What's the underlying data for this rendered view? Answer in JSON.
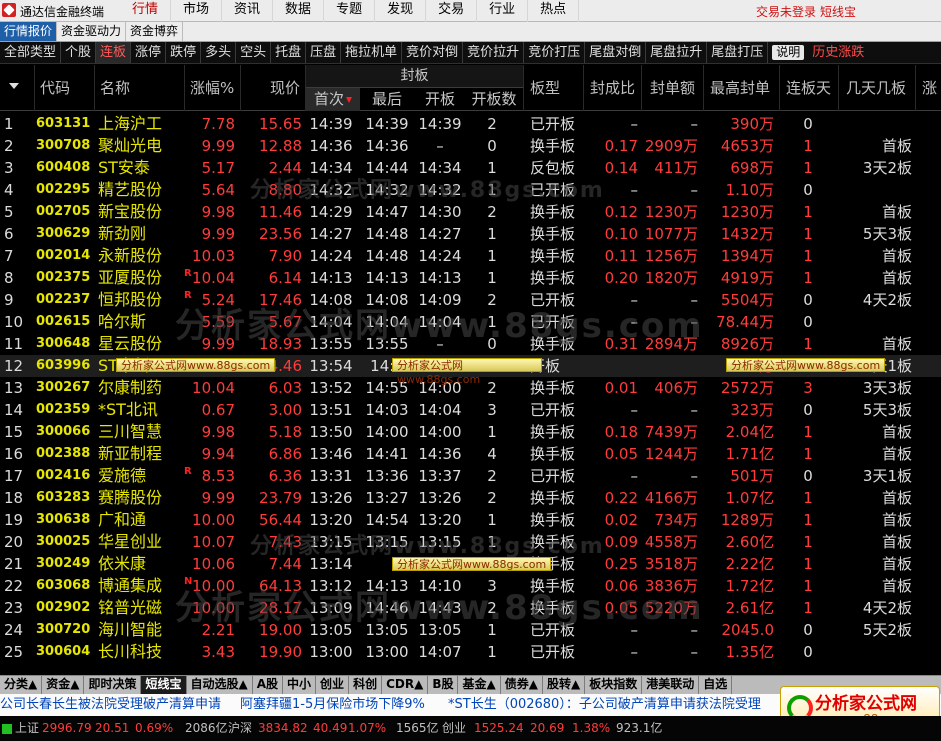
{
  "app": {
    "title": "通达信金融终端",
    "menu": [
      "行情",
      "市场",
      "资讯",
      "数据",
      "专题",
      "发现",
      "交易",
      "行业",
      "热点"
    ],
    "active_menu": 0,
    "login_status": "交易未登录",
    "short_line": "短线宝"
  },
  "subtabs": [
    "行情报价",
    "资金驱动力",
    "资金博弈"
  ],
  "categories": [
    "全部类型",
    "个股",
    "连板",
    "涨停",
    "跌停",
    "多头",
    "空头",
    "托盘",
    "压盘",
    "拖拉机单",
    "竞价对倒",
    "竞价拉升",
    "竞价打压",
    "尾盘对倒",
    "尾盘拉升",
    "尾盘打压"
  ],
  "active_category": 2,
  "cat_button": "说明",
  "cat_extra": "历史涨跌",
  "columns": {
    "code": "代码",
    "name": "名称",
    "chg": "涨幅%",
    "price": "现价",
    "group": "封板",
    "first": "首次",
    "last": "最后",
    "open": "开板",
    "open_count": "开板数",
    "btype": "板型",
    "ratio": "封成比",
    "famt": "封单额",
    "fmax": "最高封单",
    "days": "连板天",
    "nban": "几天几板",
    "more": "涨"
  },
  "rows": [
    {
      "idx": "1",
      "code": "603131",
      "name": "上海沪工",
      "mark": "",
      "chg": "7.78",
      "price": "15.65",
      "t1": "14:39",
      "t2": "14:39",
      "t3": "14:39",
      "opens": "2",
      "btype": "已开板",
      "ratio": "–",
      "famt": "–",
      "fmax": "390万",
      "days": "0",
      "nban": ""
    },
    {
      "idx": "2",
      "code": "300708",
      "name": "聚灿光电",
      "mark": "",
      "chg": "9.99",
      "price": "12.88",
      "t1": "14:36",
      "t2": "14:36",
      "t3": "–",
      "opens": "0",
      "btype": "换手板",
      "ratio": "0.17",
      "famt": "2909万",
      "fmax": "4653万",
      "days": "1",
      "nban": "首板"
    },
    {
      "idx": "3",
      "code": "600408",
      "name": "ST安泰",
      "mark": "",
      "chg": "5.17",
      "price": "2.44",
      "t1": "14:34",
      "t2": "14:44",
      "t3": "14:34",
      "opens": "1",
      "btype": "反包板",
      "ratio": "0.14",
      "famt": "411万",
      "fmax": "698万",
      "days": "1",
      "nban": "3天2板"
    },
    {
      "idx": "4",
      "code": "002295",
      "name": "精艺股份",
      "mark": "",
      "chg": "5.64",
      "price": "8.80",
      "t1": "14:32",
      "t2": "14:32",
      "t3": "14:32",
      "opens": "1",
      "btype": "已开板",
      "ratio": "–",
      "famt": "–",
      "fmax": "1.10万",
      "days": "0",
      "nban": ""
    },
    {
      "idx": "5",
      "code": "002705",
      "name": "新宝股份",
      "mark": "",
      "chg": "9.98",
      "price": "11.46",
      "t1": "14:29",
      "t2": "14:47",
      "t3": "14:30",
      "opens": "2",
      "btype": "换手板",
      "ratio": "0.12",
      "famt": "1230万",
      "fmax": "1230万",
      "days": "1",
      "nban": "首板"
    },
    {
      "idx": "6",
      "code": "300629",
      "name": "新劲刚",
      "mark": "",
      "chg": "9.99",
      "price": "23.56",
      "t1": "14:27",
      "t2": "14:48",
      "t3": "14:27",
      "opens": "1",
      "btype": "换手板",
      "ratio": "0.10",
      "famt": "1077万",
      "fmax": "1432万",
      "days": "1",
      "nban": "5天3板"
    },
    {
      "idx": "7",
      "code": "002014",
      "name": "永新股份",
      "mark": "",
      "chg": "10.03",
      "price": "7.90",
      "t1": "14:24",
      "t2": "14:48",
      "t3": "14:24",
      "opens": "1",
      "btype": "换手板",
      "ratio": "0.11",
      "famt": "1256万",
      "fmax": "1394万",
      "days": "1",
      "nban": "首板"
    },
    {
      "idx": "8",
      "code": "002375",
      "name": "亚厦股份",
      "mark": "R",
      "chg": "10.04",
      "price": "6.14",
      "t1": "14:13",
      "t2": "14:13",
      "t3": "14:13",
      "opens": "1",
      "btype": "换手板",
      "ratio": "0.20",
      "famt": "1820万",
      "fmax": "4919万",
      "days": "1",
      "nban": "首板"
    },
    {
      "idx": "9",
      "code": "002237",
      "name": "恒邦股份",
      "mark": "R",
      "chg": "5.24",
      "price": "17.46",
      "t1": "14:08",
      "t2": "14:08",
      "t3": "14:09",
      "opens": "2",
      "btype": "已开板",
      "ratio": "–",
      "famt": "–",
      "fmax": "5504万",
      "days": "0",
      "nban": "4天2板"
    },
    {
      "idx": "10",
      "code": "002615",
      "name": "哈尔斯",
      "mark": "",
      "chg": "5.59",
      "price": "5.67",
      "t1": "14:04",
      "t2": "14:04",
      "t3": "14:04",
      "opens": "1",
      "btype": "已开板",
      "ratio": "–",
      "famt": "–",
      "fmax": "78.44万",
      "days": "0",
      "nban": ""
    },
    {
      "idx": "11",
      "code": "300648",
      "name": "星云股份",
      "mark": "",
      "chg": "9.99",
      "price": "18.93",
      "t1": "13:55",
      "t2": "13:55",
      "t3": "–",
      "opens": "0",
      "btype": "换手板",
      "ratio": "0.31",
      "famt": "2894万",
      "fmax": "8926万",
      "days": "1",
      "nban": "首板"
    },
    {
      "idx": "12",
      "code": "603996",
      "name": "ST中新",
      "mark": "",
      "chg": "4.69",
      "price": "4.46",
      "t1": "13:54",
      "t2": "14:4",
      "t3": "",
      "opens": "",
      "btype": "开板",
      "ratio": "",
      "famt": "",
      "fmax": "421万",
      "days": "",
      "nban": "5天1板"
    },
    {
      "idx": "13",
      "code": "300267",
      "name": "尔康制药",
      "mark": "",
      "chg": "10.04",
      "price": "6.03",
      "t1": "13:52",
      "t2": "14:55",
      "t3": "14:00",
      "opens": "2",
      "btype": "换手板",
      "ratio": "0.01",
      "famt": "406万",
      "fmax": "2572万",
      "days": "3",
      "nban": "3天3板"
    },
    {
      "idx": "14",
      "code": "002359",
      "name": "*ST北讯",
      "mark": "",
      "chg": "0.67",
      "price": "3.00",
      "t1": "13:51",
      "t2": "14:03",
      "t3": "14:04",
      "opens": "3",
      "btype": "已开板",
      "ratio": "–",
      "famt": "–",
      "fmax": "323万",
      "days": "0",
      "nban": "5天3板"
    },
    {
      "idx": "15",
      "code": "300066",
      "name": "三川智慧",
      "mark": "",
      "chg": "9.98",
      "price": "5.18",
      "t1": "13:50",
      "t2": "14:00",
      "t3": "14:00",
      "opens": "1",
      "btype": "换手板",
      "ratio": "0.18",
      "famt": "7439万",
      "fmax": "2.04亿",
      "days": "1",
      "nban": "首板"
    },
    {
      "idx": "16",
      "code": "002388",
      "name": "新亚制程",
      "mark": "",
      "chg": "9.94",
      "price": "6.86",
      "t1": "13:46",
      "t2": "14:41",
      "t3": "14:36",
      "opens": "4",
      "btype": "换手板",
      "ratio": "0.05",
      "famt": "1244万",
      "fmax": "1.71亿",
      "days": "1",
      "nban": "首板"
    },
    {
      "idx": "17",
      "code": "002416",
      "name": "爱施德",
      "mark": "R",
      "chg": "8.53",
      "price": "6.36",
      "t1": "13:31",
      "t2": "13:36",
      "t3": "13:37",
      "opens": "2",
      "btype": "已开板",
      "ratio": "–",
      "famt": "–",
      "fmax": "501万",
      "days": "0",
      "nban": "3天1板"
    },
    {
      "idx": "18",
      "code": "603283",
      "name": "赛腾股份",
      "mark": "",
      "chg": "9.99",
      "price": "23.79",
      "t1": "13:26",
      "t2": "13:27",
      "t3": "13:26",
      "opens": "2",
      "btype": "换手板",
      "ratio": "0.22",
      "famt": "4166万",
      "fmax": "1.07亿",
      "days": "1",
      "nban": "首板"
    },
    {
      "idx": "19",
      "code": "300638",
      "name": "广和通",
      "mark": "",
      "chg": "10.00",
      "price": "56.44",
      "t1": "13:20",
      "t2": "14:54",
      "t3": "13:20",
      "opens": "1",
      "btype": "换手板",
      "ratio": "0.02",
      "famt": "734万",
      "fmax": "1289万",
      "days": "1",
      "nban": "首板"
    },
    {
      "idx": "20",
      "code": "300025",
      "name": "华星创业",
      "mark": "",
      "chg": "10.07",
      "price": "7.43",
      "t1": "13:15",
      "t2": "13:15",
      "t3": "13:15",
      "opens": "1",
      "btype": "换手板",
      "ratio": "0.09",
      "famt": "4558万",
      "fmax": "2.60亿",
      "days": "1",
      "nban": "首板"
    },
    {
      "idx": "21",
      "code": "300249",
      "name": "依米康",
      "mark": "",
      "chg": "10.06",
      "price": "7.44",
      "t1": "13:14",
      "t2": "",
      "t3": "",
      "opens": "",
      "btype": "换手板",
      "ratio": "0.25",
      "famt": "3518万",
      "fmax": "2.22亿",
      "days": "1",
      "nban": "首板"
    },
    {
      "idx": "22",
      "code": "603068",
      "name": "博通集成",
      "mark": "N",
      "chg": "10.00",
      "price": "64.13",
      "t1": "13:12",
      "t2": "14:13",
      "t3": "14:10",
      "opens": "3",
      "btype": "换手板",
      "ratio": "0.06",
      "famt": "3836万",
      "fmax": "1.72亿",
      "days": "1",
      "nban": "首板"
    },
    {
      "idx": "23",
      "code": "002902",
      "name": "铭普光磁",
      "mark": "",
      "chg": "10.00",
      "price": "28.17",
      "t1": "13:09",
      "t2": "14:46",
      "t3": "14:43",
      "opens": "2",
      "btype": "换手板",
      "ratio": "0.05",
      "famt": "5220万",
      "fmax": "2.61亿",
      "days": "1",
      "nban": "4天2板"
    },
    {
      "idx": "24",
      "code": "300720",
      "name": "海川智能",
      "mark": "",
      "chg": "2.21",
      "price": "19.00",
      "t1": "13:05",
      "t2": "13:05",
      "t3": "13:05",
      "opens": "1",
      "btype": "已开板",
      "ratio": "–",
      "famt": "–",
      "fmax": "2045.0",
      "days": "0",
      "nban": "5天2板"
    },
    {
      "idx": "25",
      "code": "300604",
      "name": "长川科技",
      "mark": "",
      "chg": "3.43",
      "price": "19.90",
      "t1": "13:00",
      "t2": "13:00",
      "t3": "14:07",
      "opens": "1",
      "btype": "已开板",
      "ratio": "–",
      "famt": "–",
      "fmax": "1.35亿",
      "days": "0",
      "nban": ""
    }
  ],
  "ads": [
    "分析家公式网www.88gs.com",
    "分析家公式网www.88gs.com",
    "分析家公式网www.88gs.com",
    "分析家公式网www.88gs.com"
  ],
  "watermark": "分析家公式网www.88gs.com",
  "bottom_tabs": [
    "分类▲",
    "资金▲",
    "即时决策",
    "短线宝",
    "自动选股▲",
    "A股",
    "中小",
    "创业",
    "科创",
    "CDR▲",
    "B股",
    "基金▲",
    "债券▲",
    "股转▲",
    "板块指数",
    "港美联动",
    "自选"
  ],
  "active_bottom_tab": 3,
  "news": [
    "公司长春长生被法院受理破产清算申请",
    "阿塞拜疆1-5月保险市场下降9%",
    "*ST长生（002680）：子公司破产清算申请获法院受理"
  ],
  "brand": {
    "name": "分析家公式网",
    "url": "www.88gs.com"
  },
  "status": {
    "sh_label": "上证",
    "sh_index": "2996.79",
    "sh_chg": "20.51",
    "sh_pct": "0.69%",
    "sh_vol": "2086亿",
    "sz_label": "沪深",
    "sz_index": "3834.82",
    "sz_chg": "40.49",
    "sz_pct": "1.07%",
    "sz_vol": "1565亿",
    "cy_label": "创业",
    "cy_index": "1525.24",
    "cy_chg": "20.69",
    "cy_pct": "1.38%",
    "cy_vol": "923.1亿"
  }
}
